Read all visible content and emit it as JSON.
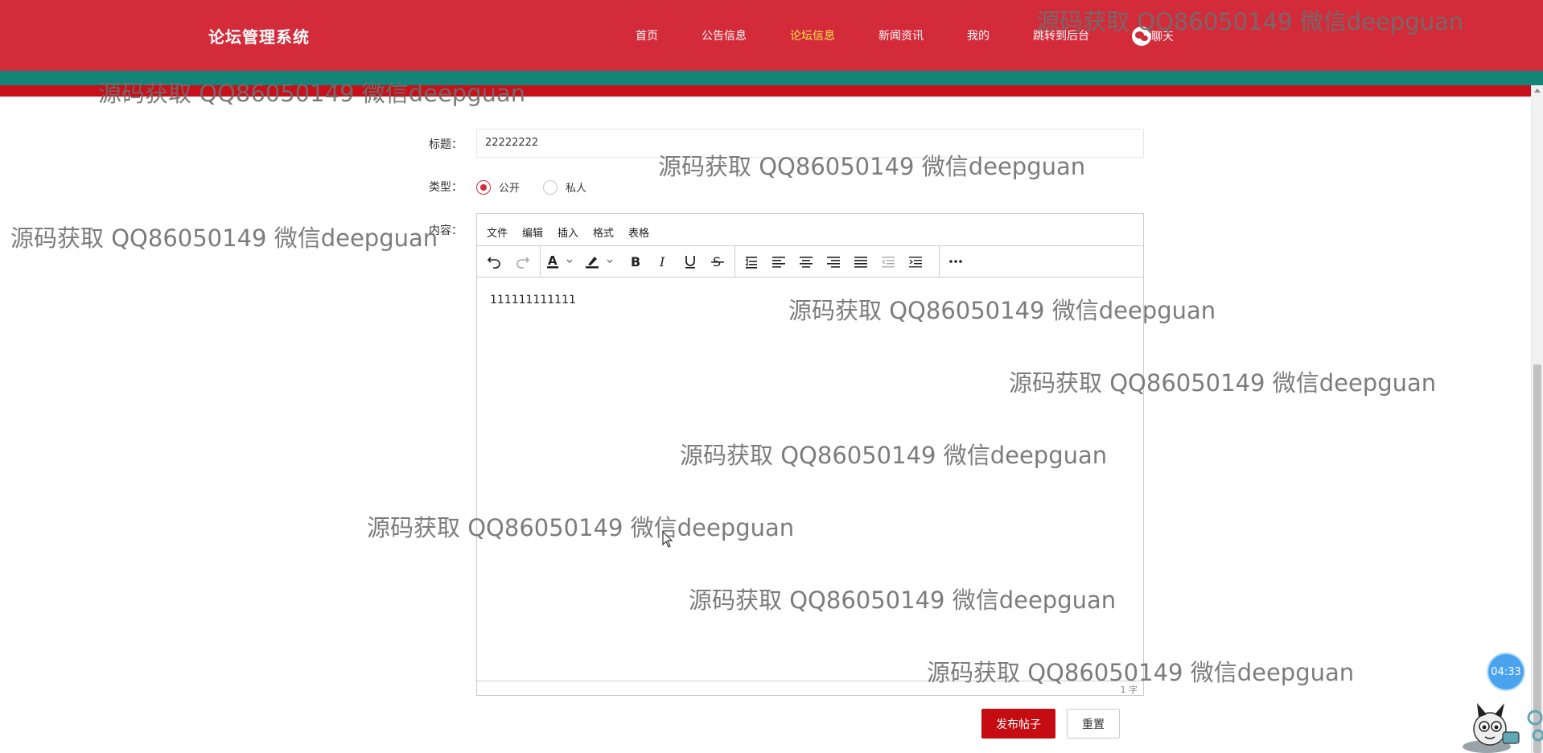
{
  "header": {
    "brand": "论坛管理系统",
    "nav": [
      {
        "label": "首页",
        "active": false
      },
      {
        "label": "公告信息",
        "active": false
      },
      {
        "label": "论坛信息",
        "active": true
      },
      {
        "label": "新闻资讯",
        "active": false
      },
      {
        "label": "我的",
        "active": false
      },
      {
        "label": "跳转到后台",
        "active": false
      }
    ],
    "chat_label": "聊天",
    "active_color": "#ffe34d",
    "bg_color": "#d42b3a"
  },
  "form": {
    "title_label": "标题：",
    "title_value": "22222222",
    "type_label": "类型：",
    "type_options": [
      {
        "label": "公开",
        "checked": true
      },
      {
        "label": "私人",
        "checked": false
      }
    ],
    "content_label": "内容：",
    "editor": {
      "menus": [
        "文件",
        "编辑",
        "插入",
        "格式",
        "表格"
      ],
      "toolbar_icons": [
        "undo-icon",
        "redo-icon",
        "text-color-icon",
        "highlight-color-icon",
        "bold-icon",
        "italic-icon",
        "underline-icon",
        "strikethrough-icon",
        "line-height-icon",
        "align-left-icon",
        "align-center-icon",
        "align-right-icon",
        "align-justify-icon",
        "outdent-icon",
        "indent-icon",
        "more-icon"
      ],
      "content": "111111111111",
      "word_count": "1 字"
    },
    "submit_label": "发布帖子",
    "reset_label": "重置"
  },
  "watermark": "源码获取 QQ86050149 微信deepguan",
  "timer": "04:33"
}
